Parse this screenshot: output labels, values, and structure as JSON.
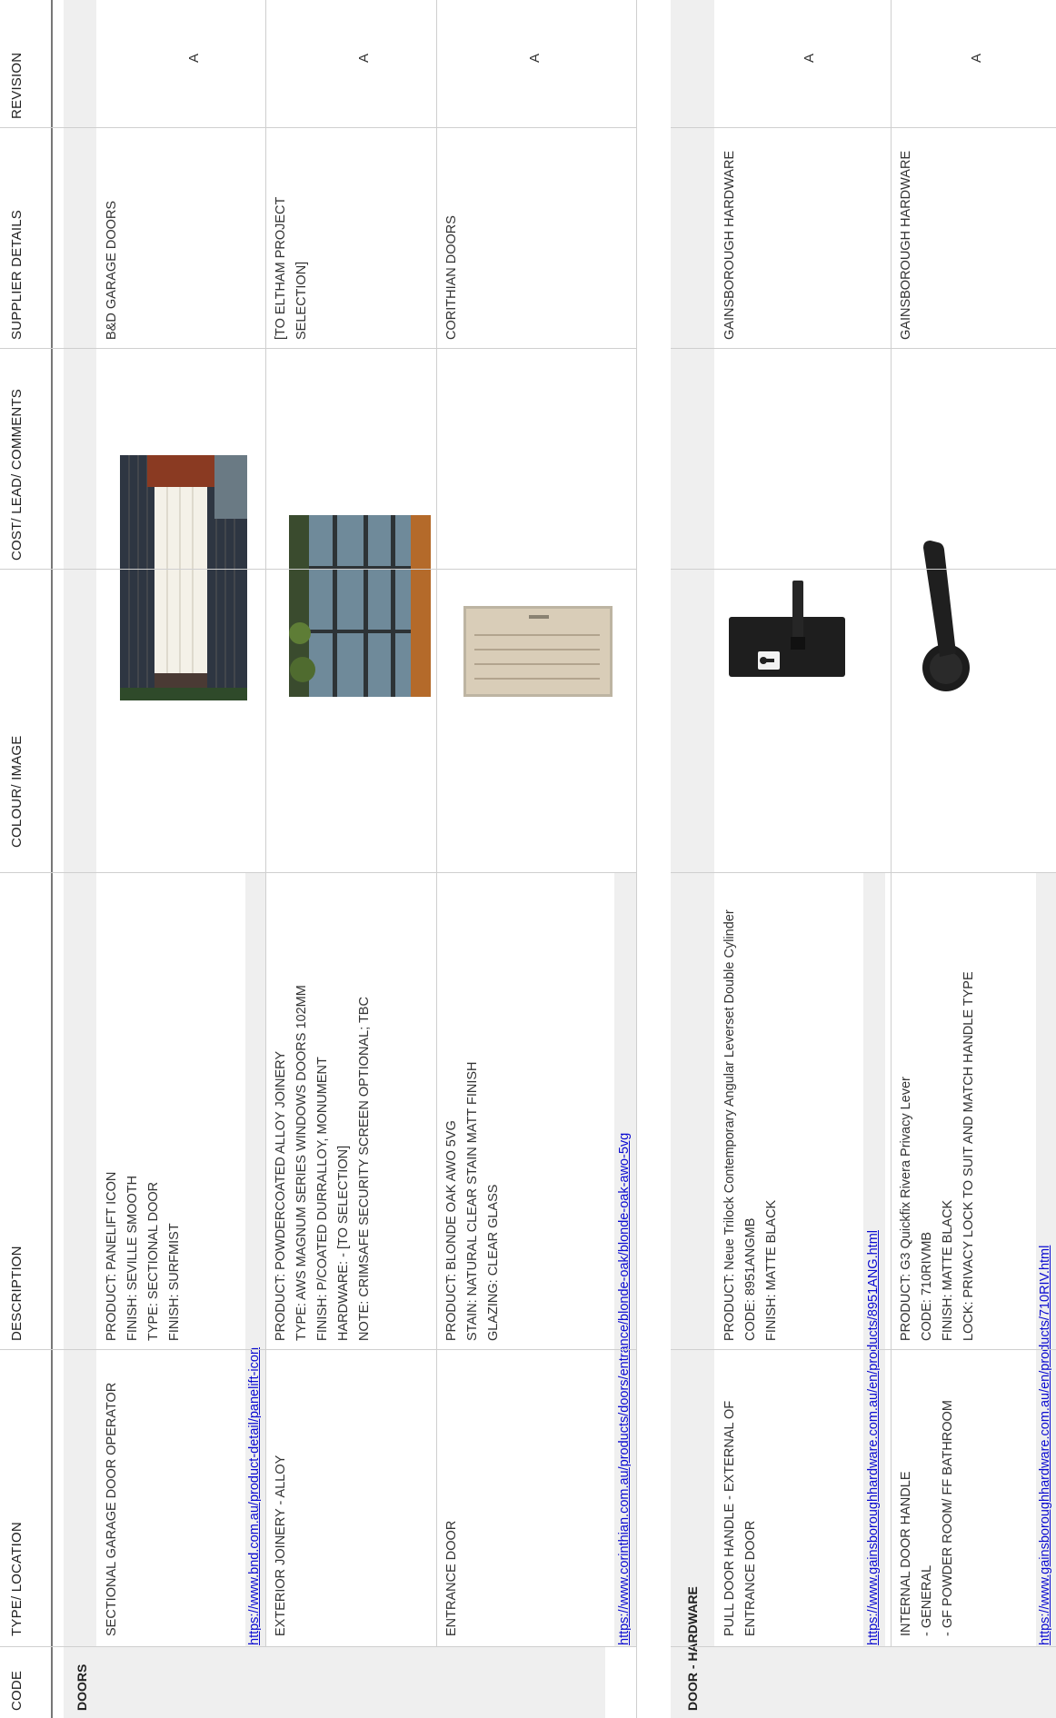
{
  "headers": {
    "code": "CODE",
    "type_location": "TYPE/ LOCATION",
    "description": "DESCRIPTION",
    "colour_image": "COLOUR/ IMAGE",
    "cost_lead_comments": "COST/ LEAD/ COMMENTS",
    "supplier_details": "SUPPLIER DETAILS",
    "revision": "REVISION"
  },
  "sections": [
    {
      "title": "DOORS",
      "rows": [
        {
          "type_location": [
            "SECTIONAL GARAGE DOOR OPERATOR"
          ],
          "description": [
            "PRODUCT: PANELIFT ICON",
            "FINISH: SEVILLE SMOOTH",
            "TYPE: SECTIONAL DOOR",
            "FINISH: SURFMIST"
          ],
          "link": "https://www.bnd.com.au/product-detail/panelift-icon",
          "image": "garage-door-photo",
          "supplier": [
            "B&D GARAGE DOORS"
          ],
          "revision": "A"
        },
        {
          "type_location": [
            "EXTERIOR JOINERY - ALLOY"
          ],
          "description": [
            "PRODUCT: POWDERCOATED ALLOY JOINERY",
            "TYPE: AWS MAGNUM SERIES WINDOWS DOORS 102MM",
            "FINISH: P/COATED DURRALLOY, MONUMENT",
            "HARDWARE: - [TO SELECTION]",
            "NOTE: CRIMSAFE SECURITY SCREEN OPTIONAL; TBC"
          ],
          "link": "",
          "image": "sliding-door-photo",
          "supplier": [
            "[TO ELTHAM PROJECT",
            "SELECTION]"
          ],
          "revision": "A"
        },
        {
          "type_location": [
            "ENTRANCE DOOR"
          ],
          "description": [
            "PRODUCT: BLONDE OAK AWO 5VG",
            "STAIN: NATURAL CLEAR STAIN MATT FINISH",
            "GLAZING: CLEAR GLASS"
          ],
          "link": "https://www.corinthian.com.au/products/doors/entrance/blonde-oak/blonde-oak-awo-5vg",
          "image": "entrance-door-photo",
          "supplier": [
            "CORITHIAN DOORS"
          ],
          "revision": "A"
        }
      ]
    },
    {
      "title": "DOOR - HARDWARE",
      "rows": [
        {
          "type_location": [
            "PULL DOOR HANDLE - EXTERNAL OF",
            "ENTRANCE DOOR"
          ],
          "description": [
            "PRODUCT: Neue Trilock Contemporary Angular Leverset Double Cylinder",
            "CODE: 8951ANGMB",
            "FINISH: MATTE BLACK"
          ],
          "link": "https://www.gainsboroughhardware.com.au/en/products/8951ANG.html",
          "image": "leverset-photo",
          "supplier": [
            "GAINSBOROUGH HARDWARE"
          ],
          "revision": "A"
        },
        {
          "type_location": [
            "INTERNAL DOOR HANDLE",
            "- GENERAL",
            "- GF POWDER ROOM/ FF BATHROOM"
          ],
          "description": [
            "PRODUCT: G3 Quickfix Rivera Privacy Lever",
            "CODE: 710RIVMB",
            "FINISH: MATTE BLACK",
            "LOCK: PRIVACY LOCK TO SUIT AND MATCH HANDLE TYPE"
          ],
          "link": "https://www.gainsboroughhardware.com.au/en/products/710RIV.html",
          "image": "privacy-lever-photo",
          "supplier": [
            "GAINSBOROUGH HARDWARE"
          ],
          "revision": "A"
        }
      ]
    }
  ]
}
